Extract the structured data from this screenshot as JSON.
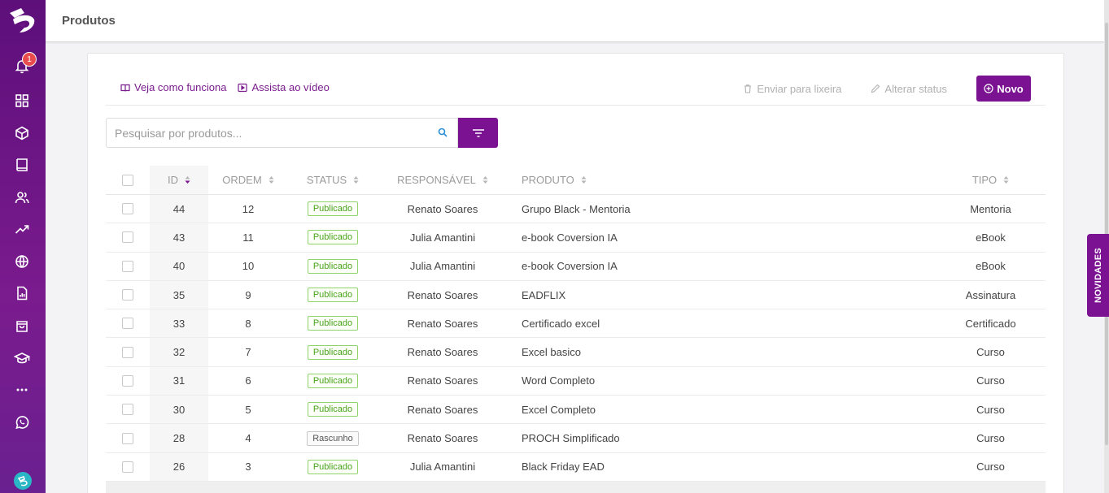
{
  "header": {
    "title": "Produtos"
  },
  "sidebar": {
    "notification_count": "1"
  },
  "toolbar": {
    "how_it_works": "Veja como funciona",
    "watch_video": "Assista ao vídeo",
    "trash": "Enviar para lixeira",
    "change_status": "Alterar status",
    "new": "Novo"
  },
  "search": {
    "placeholder": "Pesquisar por produtos..."
  },
  "table": {
    "columns": {
      "id": "ID",
      "order": "ORDEM",
      "status": "STATUS",
      "owner": "RESPONSÁVEL",
      "product": "PRODUTO",
      "type": "TIPO"
    },
    "rows": [
      {
        "id": "44",
        "order": "12",
        "status": "Publicado",
        "owner": "Renato Soares",
        "product": "Grupo Black - Mentoria",
        "type": "Mentoria"
      },
      {
        "id": "43",
        "order": "11",
        "status": "Publicado",
        "owner": "Julia Amantini",
        "product": "e-book Coversion IA",
        "type": "eBook"
      },
      {
        "id": "40",
        "order": "10",
        "status": "Publicado",
        "owner": "Julia Amantini",
        "product": "e-book Coversion IA",
        "type": "eBook"
      },
      {
        "id": "35",
        "order": "9",
        "status": "Publicado",
        "owner": "Renato Soares",
        "product": "EADFLIX",
        "type": "Assinatura"
      },
      {
        "id": "33",
        "order": "8",
        "status": "Publicado",
        "owner": "Renato Soares",
        "product": "Certificado excel",
        "type": "Certificado"
      },
      {
        "id": "32",
        "order": "7",
        "status": "Publicado",
        "owner": "Renato Soares",
        "product": "Excel basico",
        "type": "Curso"
      },
      {
        "id": "31",
        "order": "6",
        "status": "Publicado",
        "owner": "Renato Soares",
        "product": "Word Completo",
        "type": "Curso"
      },
      {
        "id": "30",
        "order": "5",
        "status": "Publicado",
        "owner": "Renato Soares",
        "product": "Excel Completo",
        "type": "Curso"
      },
      {
        "id": "28",
        "order": "4",
        "status": "Rascunho",
        "owner": "Renato Soares",
        "product": "PROCH Simplificado",
        "type": "Curso"
      },
      {
        "id": "26",
        "order": "3",
        "status": "Publicado",
        "owner": "Julia Amantini",
        "product": "Black Friday EAD",
        "type": "Curso"
      }
    ]
  },
  "side_tab": {
    "label": "NOVIDADES"
  },
  "colors": {
    "brand": "#7b1292",
    "published": "#4aa31b",
    "badge": "#e84c4c"
  }
}
